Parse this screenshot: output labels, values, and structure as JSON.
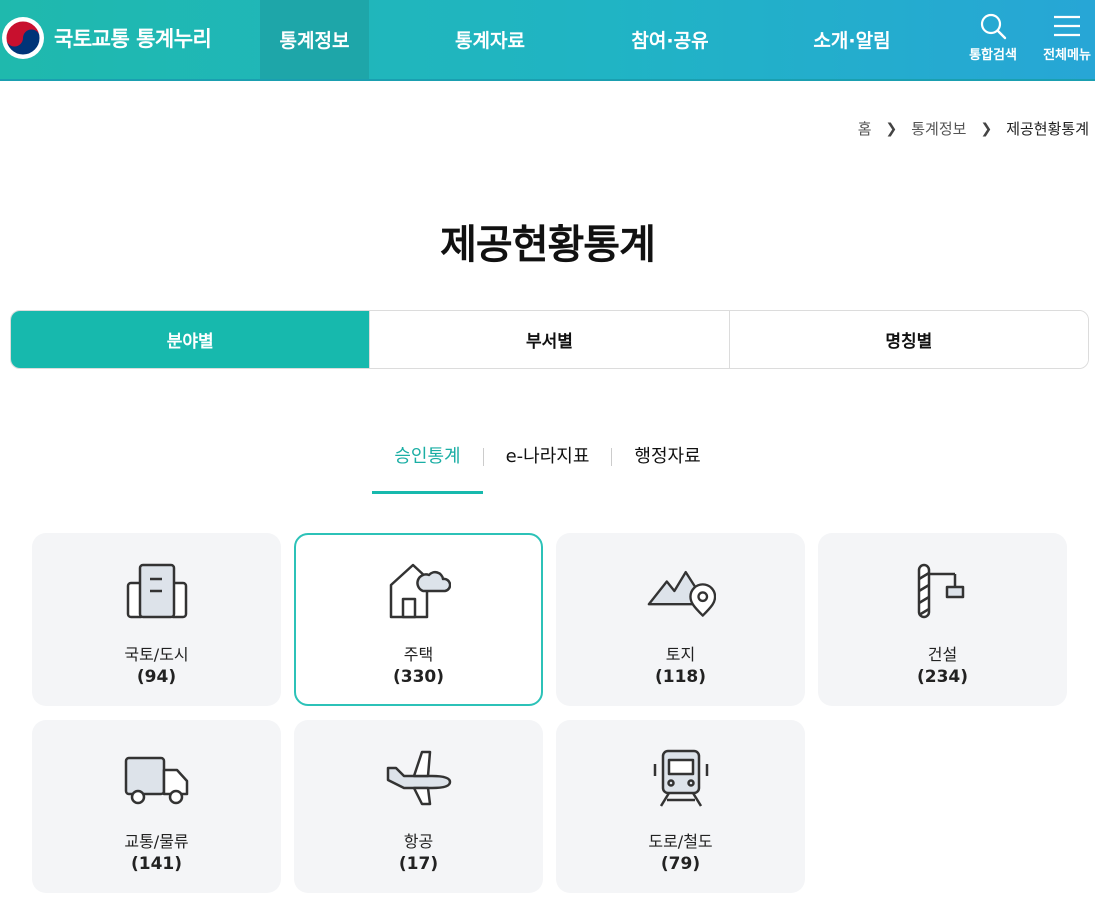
{
  "header": {
    "logo_text": "국토교통 통계누리",
    "nav": [
      "통계정보",
      "통계자료",
      "참여·공유",
      "소개·알림"
    ],
    "search_label": "통합검색",
    "menu_label": "전체메뉴"
  },
  "breadcrumb": [
    "홈",
    "통계정보",
    "제공현황통계"
  ],
  "page_title": "제공현황통계",
  "tabs": [
    "분야별",
    "부서별",
    "명칭별"
  ],
  "subtabs": [
    "승인통계",
    "e-나라지표",
    "행정자료"
  ],
  "cards": [
    {
      "name": "국토/도시",
      "count": "(94)",
      "icon": "building-icon"
    },
    {
      "name": "주택",
      "count": "(330)",
      "icon": "house-icon"
    },
    {
      "name": "토지",
      "count": "(118)",
      "icon": "land-icon"
    },
    {
      "name": "건설",
      "count": "(234)",
      "icon": "construction-icon"
    },
    {
      "name": "교통/물류",
      "count": "(141)",
      "icon": "truck-icon"
    },
    {
      "name": "항공",
      "count": "(17)",
      "icon": "airplane-icon"
    },
    {
      "name": "도로/철도",
      "count": "(79)",
      "icon": "train-icon"
    }
  ],
  "colors": {
    "accent": "#17b9ad",
    "header_start": "#1fb9ad",
    "header_end": "#27a6d6"
  }
}
